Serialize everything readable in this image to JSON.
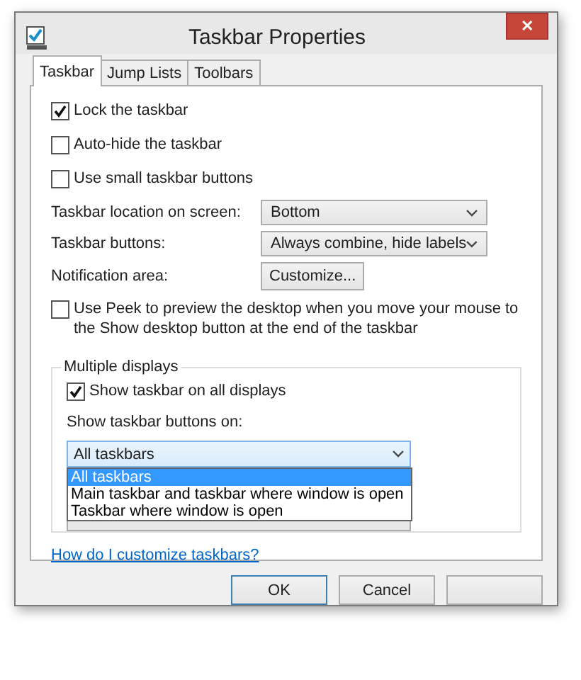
{
  "window": {
    "title": "Taskbar Properties",
    "close": "✕"
  },
  "tabs": [
    {
      "label": "Taskbar",
      "selected": true
    },
    {
      "label": "Jump Lists",
      "selected": false
    },
    {
      "label": "Toolbars",
      "selected": false
    }
  ],
  "options": [
    {
      "label": "Lock the taskbar",
      "checked": true
    },
    {
      "label": "Auto-hide the taskbar",
      "checked": false
    },
    {
      "label": "Use small taskbar buttons",
      "checked": false
    }
  ],
  "settings": [
    {
      "kind": "select",
      "label": "Taskbar location on screen:",
      "value": "Bottom"
    },
    {
      "kind": "select",
      "label": "Taskbar buttons:",
      "value": "Always combine, hide labels"
    },
    {
      "kind": "button",
      "label": "Notification area:",
      "value": "Customize..."
    }
  ],
  "peek": {
    "label": "Use Peek to preview the desktop when you move your mouse to the Show desktop button at the end of the taskbar",
    "checked": false
  },
  "multiple_displays": {
    "title": "Multiple displays",
    "show_all": {
      "label": "Show taskbar on all displays",
      "checked": true
    },
    "buttons_on": {
      "label": "Show taskbar buttons on:",
      "value": "All taskbars",
      "expanded": true,
      "options": [
        {
          "label": "All taskbars",
          "selected": true
        },
        {
          "label": "Main taskbar and taskbar where window is open",
          "selected": false
        },
        {
          "label": "Taskbar where window is open",
          "selected": false
        }
      ]
    }
  },
  "help_link": "How do I customize taskbars?",
  "buttons": [
    {
      "label": "OK",
      "default": true
    },
    {
      "label": "Cancel",
      "default": false
    }
  ]
}
